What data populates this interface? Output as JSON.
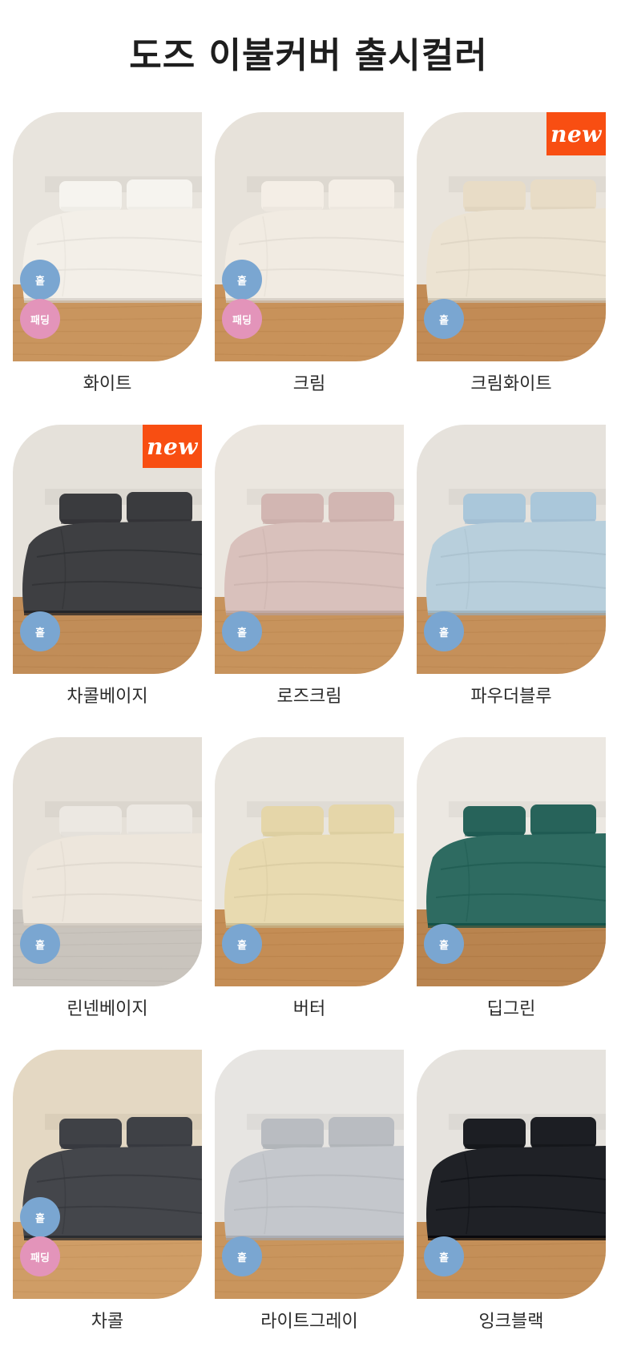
{
  "title": "도즈 이불커버 출시컬러",
  "badge_new_label": "new",
  "tag_labels": {
    "hol": "홑",
    "pad": "패딩"
  },
  "colors": [
    {
      "name": "화이트",
      "duvet": "#f3efe8",
      "pillow": "#f6f4ef",
      "wall": "#e8e4dd",
      "floor": "#c9955e",
      "new": false,
      "tags": [
        "hol",
        "pad"
      ]
    },
    {
      "name": "크림",
      "duvet": "#f1ebe2",
      "pillow": "#f4eee6",
      "wall": "#e7e2da",
      "floor": "#c8925a",
      "new": false,
      "tags": [
        "hol",
        "pad"
      ]
    },
    {
      "name": "크림화이트",
      "duvet": "#ece3d2",
      "pillow": "#e8dcc6",
      "wall": "#e9e4dc",
      "floor": "#c28b55",
      "new": true,
      "tags": [
        "hol"
      ]
    },
    {
      "name": "차콜베이지",
      "duvet": "#3e3f42",
      "pillow": "#3a3b3e",
      "wall": "#e5e1da",
      "floor": "#c18d58",
      "new": true,
      "tags": [
        "hol"
      ]
    },
    {
      "name": "로즈크림",
      "duvet": "#d9c1bc",
      "pillow": "#d2b6b2",
      "wall": "#ebe6df",
      "floor": "#c7935c",
      "new": false,
      "tags": [
        "hol"
      ]
    },
    {
      "name": "파우더블루",
      "duvet": "#b8cfdc",
      "pillow": "#aac7da",
      "wall": "#e6e2dc",
      "floor": "#c5905a",
      "new": false,
      "tags": [
        "hol"
      ]
    },
    {
      "name": "린넨베이지",
      "duvet": "#ede6dc",
      "pillow": "#ece8e2",
      "wall": "#e5e0d8",
      "floor": "#c9c4bd",
      "new": false,
      "tags": [
        "hol"
      ]
    },
    {
      "name": "버터",
      "duvet": "#e8dab0",
      "pillow": "#e5d6a9",
      "wall": "#e9e5de",
      "floor": "#c48d55",
      "new": false,
      "tags": [
        "hol"
      ]
    },
    {
      "name": "딥그린",
      "duvet": "#2e6b61",
      "pillow": "#27635a",
      "wall": "#ece8e2",
      "floor": "#b9844f",
      "new": false,
      "tags": [
        "hol"
      ]
    },
    {
      "name": "차콜",
      "duvet": "#44464b",
      "pillow": "#3f4146",
      "wall": "#e4d8c3",
      "floor": "#cf9d66",
      "new": false,
      "tags": [
        "hol",
        "pad"
      ]
    },
    {
      "name": "라이트그레이",
      "duvet": "#c4c7cc",
      "pillow": "#b9bcc1",
      "wall": "#e7e5e2",
      "floor": "#c9955d",
      "new": false,
      "tags": [
        "hol"
      ]
    },
    {
      "name": "잉크블랙",
      "duvet": "#1f2126",
      "pillow": "#1c1e23",
      "wall": "#e6e3de",
      "floor": "#c48f58",
      "new": false,
      "tags": [
        "hol"
      ]
    }
  ]
}
